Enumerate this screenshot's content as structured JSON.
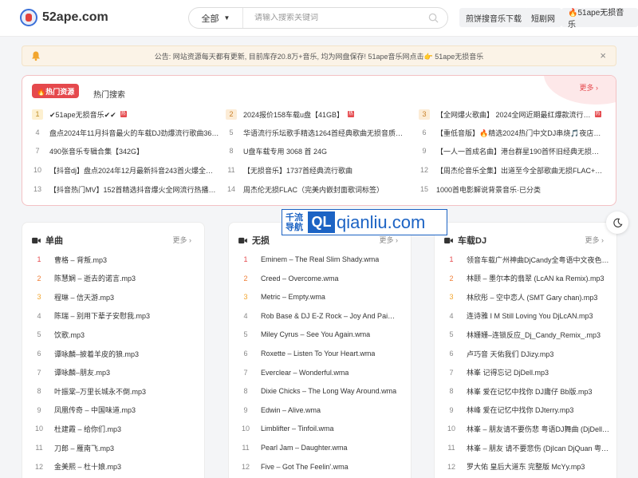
{
  "header": {
    "logo_text": "52ape.com",
    "search": {
      "category": "全部",
      "placeholder": "请输入搜索关键词"
    },
    "nav": [
      "煎饼搜音乐下载",
      "短剧网",
      "🔥51ape无损音乐"
    ]
  },
  "notice": {
    "text": "公告: 网站资源每天都有更新, 目前库存20.8万+音乐, 均为网盘保存! 51ape音乐网点击👉 51ape无损音乐"
  },
  "hot": {
    "badge": "🔥热门资源",
    "title": "热门搜索",
    "more": "更多 ›",
    "items": [
      {
        "num": "1",
        "text": "✔51ape无损音乐✔✔",
        "tag": "热"
      },
      {
        "num": "2",
        "text": "2024报价158车载u盘【41GB】",
        "tag": "热"
      },
      {
        "num": "3",
        "text": "【全网爆火歌曲】 2024全网近期最红爆款流行…",
        "tag": "热"
      },
      {
        "num": "4",
        "text": "盘点2024年11月抖音最火的车载DJ劲爆流行歌曲36…"
      },
      {
        "num": "5",
        "text": "华语流行乐坛歌手精选1264首经典歌曲无损音质合…"
      },
      {
        "num": "6",
        "text": "【重低音版】🔥精选2024热门中文DJ串烧🎵夜店…"
      },
      {
        "num": "7",
        "text": "490张音乐专辑合集【342G】"
      },
      {
        "num": "8",
        "text": "U盘车载专用 3068 首 24G"
      },
      {
        "num": "9",
        "text": "【一人一首成名曲】港台群星190首怀旧经典无损音…"
      },
      {
        "num": "10",
        "text": "【抖音dj】盘点2024年12月最新抖音243首火爆全…"
      },
      {
        "num": "11",
        "text": "【无损音乐】1737首经典流行歌曲"
      },
      {
        "num": "12",
        "text": "【周杰伦音乐全集】出道至今全部歌曲无损FLAC+MP…"
      },
      {
        "num": "13",
        "text": "【抖音热门MV】152首精选抖音爆火全网流行热播…"
      },
      {
        "num": "14",
        "text": "周杰伦无损FLAC（完美内嵌封面歌词标签）"
      },
      {
        "num": "15",
        "text": "1000首电影解说背景音乐·已分类"
      }
    ]
  },
  "watermark": {
    "cn_line1": "千流",
    "cn_line2": "导航",
    "ql": "QL",
    "domain": "qianliu.com"
  },
  "panels": [
    {
      "title": "单曲",
      "more": "更多 ›",
      "songs": [
        "曹格 – 背叛.mp3",
        "陈慧娴 – 逝去的诺言.mp3",
        "程琳 – 信天游.mp3",
        "陈瑞 – 别用下辈子安慰我.mp3",
        "饮歌.mp3",
        "谭咏麟–披着羊皮的狼.mp3",
        "谭咏麟–朋友.mp3",
        "叶振棠–万里长城永不倒.mp3",
        "凤凰传奇 – 中国味道.mp3",
        "杜建霞 – 给你们.mp3",
        "刀郎 – 雁南飞.mp3",
        "金美熙 – 杜十娘.mp3"
      ]
    },
    {
      "title": "无损",
      "more": "更多 ›",
      "songs": [
        "Eminem – The Real Slim Shady.wma",
        "Creed – Overcome.wma",
        "Metric – Empty.wma",
        "Rob Base & DJ E-Z Rock – Joy And Pai…",
        "Miley Cyrus – See You Again.wma",
        "Roxette – Listen To Your Heart.wma",
        "Everclear – Wonderful.wma",
        "Dixie Chicks – The Long Way Around.wma",
        "Edwin – Alive.wma",
        "Limblifter – Tinfoil.wma",
        "Pearl Jam – Daughter.wma",
        "Five – Got The Feelin'.wma"
      ]
    },
    {
      "title": "车载DJ",
      "more": "更多 ›",
      "songs": [
        "领音车载广州神曲DjCandy全粤语中文夜色…",
        "林颐 – 墨尔本的翡翠 (LcAN ka Remix).mp3",
        "林欣彤 – 空中恋人 (SMT Gary chan).mp3",
        "连诗雅 I M Still Loving You DjLcAN.mp3",
        "林姗姗–连锁反应_Dj_Candy_Remix_.mp3",
        "卢巧音 天佑我们 DJizy.mp3",
        "林峯 记得忘记 DjDell.mp3",
        "林峯 爱在记忆中找你 DJ庸仔 Bb版.mp3",
        "林峰 爱在记忆中找你 DJterry.mp3",
        "林峯 – 朋友请不要伤悲 粤语DJ舞曲 (DjDell…",
        "林峯 – 朋友 请不要悲伤 (DjIcan DjQuan 粤…",
        "罗大佑 皇后大道东 完整版 McYy.mp3"
      ]
    }
  ]
}
